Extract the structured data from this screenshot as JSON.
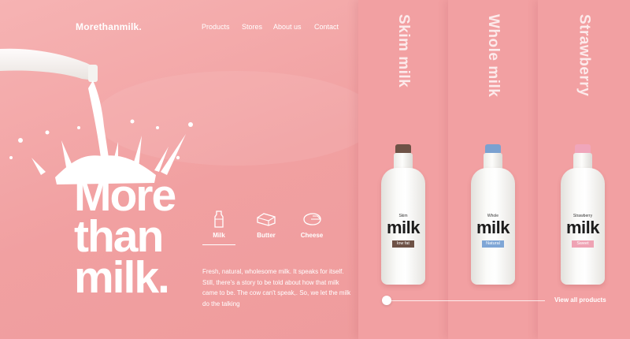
{
  "brand": {
    "logo": "Morethanmilk."
  },
  "nav": {
    "items": [
      "Products",
      "Stores",
      "About us",
      "Contact"
    ]
  },
  "hero": {
    "lines": [
      "More",
      "than",
      "milk."
    ]
  },
  "categories": {
    "items": [
      {
        "label": "Milk",
        "icon": "milk-bottle-icon",
        "active": true
      },
      {
        "label": "Butter",
        "icon": "butter-icon",
        "active": false
      },
      {
        "label": "Cheese",
        "icon": "cheese-icon",
        "active": false
      }
    ]
  },
  "description": "Fresh, natural, wholesome milk. It speaks for itself. Still, there's a story to be told about how that milk came to be. The cow can't speak,. So, we let the milk do the talking",
  "products": [
    {
      "title": "Skim milk",
      "sub": "Skim",
      "milk": "milk",
      "tag": "low fat",
      "cap_color": "#6e5246",
      "tag_color": "#6e5246"
    },
    {
      "title": "Whole milk",
      "sub": "Whole",
      "milk": "milk",
      "tag": "Natural",
      "cap_color": "#7ba1d0",
      "tag_color": "#7fa6d6"
    },
    {
      "title": "Strawberry",
      "sub": "Strawberry",
      "milk": "milk",
      "tag": "Sweet",
      "cap_color": "#f0a6bb",
      "tag_color": "#efa3b4"
    }
  ],
  "view_all": "View all products",
  "colors": {
    "background": "#f2a3a4",
    "panel": "#f2a0a2",
    "text": "#ffffff"
  }
}
